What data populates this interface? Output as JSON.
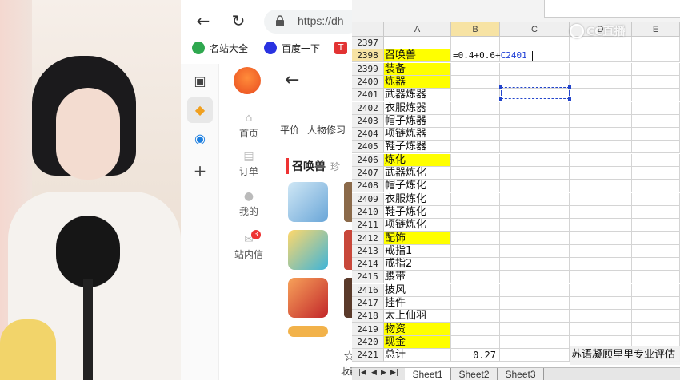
{
  "browser": {
    "url": "https://dh",
    "bookmarks": [
      {
        "label": "名站大全",
        "icon": "site-directory-icon",
        "color": "#2fa84f"
      },
      {
        "label": "百度一下",
        "icon": "baidu-paw-icon",
        "color": "#2932e1"
      },
      {
        "label": "T",
        "icon": "toutiao-icon",
        "color": "#e23333"
      }
    ],
    "app_nav": [
      {
        "label": "首页",
        "icon": "home-icon"
      },
      {
        "label": "订单",
        "icon": "order-icon"
      },
      {
        "label": "我的",
        "icon": "profile-icon"
      },
      {
        "label": "站内信",
        "icon": "message-icon",
        "badge": "3"
      }
    ],
    "tabs": [
      "平价",
      "人物修习"
    ],
    "section_title": "召唤兽",
    "section_more": "珍",
    "favorite_label": "收藏"
  },
  "sheet": {
    "columns": [
      "A",
      "B",
      "C",
      "D",
      "E"
    ],
    "rows": [
      {
        "num": "2397",
        "a": "",
        "yellow": false
      },
      {
        "num": "2398",
        "a": "召唤兽",
        "yellow": true
      },
      {
        "num": "2399",
        "a": "装备",
        "yellow": true
      },
      {
        "num": "2400",
        "a": "炼器",
        "yellow": true
      },
      {
        "num": "2401",
        "a": "武器炼器",
        "yellow": false
      },
      {
        "num": "2402",
        "a": "衣服炼器",
        "yellow": false
      },
      {
        "num": "2403",
        "a": "帽子炼器",
        "yellow": false
      },
      {
        "num": "2404",
        "a": "项链炼器",
        "yellow": false
      },
      {
        "num": "2405",
        "a": "鞋子炼器",
        "yellow": false
      },
      {
        "num": "2406",
        "a": "炼化",
        "yellow": true
      },
      {
        "num": "2407",
        "a": "武器炼化",
        "yellow": false
      },
      {
        "num": "2408",
        "a": "帽子炼化",
        "yellow": false
      },
      {
        "num": "2409",
        "a": "衣服炼化",
        "yellow": false
      },
      {
        "num": "2410",
        "a": "鞋子炼化",
        "yellow": false
      },
      {
        "num": "2411",
        "a": "项链炼化",
        "yellow": false
      },
      {
        "num": "2412",
        "a": "配饰",
        "yellow": true
      },
      {
        "num": "2413",
        "a": "戒指1",
        "yellow": false
      },
      {
        "num": "2414",
        "a": "戒指2",
        "yellow": false
      },
      {
        "num": "2415",
        "a": "腰带",
        "yellow": false
      },
      {
        "num": "2416",
        "a": "披风",
        "yellow": false
      },
      {
        "num": "2417",
        "a": "挂件",
        "yellow": false
      },
      {
        "num": "2418",
        "a": "太上仙羽",
        "yellow": false
      },
      {
        "num": "2419",
        "a": "物资",
        "yellow": true
      },
      {
        "num": "2420",
        "a": "现金",
        "yellow": true
      },
      {
        "num": "2421",
        "a": "总计",
        "yellow": false
      }
    ],
    "formula_prefix": "=0.4+0.6+",
    "formula_ref": "C2401",
    "total_value": "0.27",
    "sheet_tabs": [
      "Sheet1",
      "Sheet2",
      "Sheet3"
    ],
    "active_sheet": "Sheet1"
  },
  "overlay": {
    "watermark": "CC直播",
    "ticker": "苏语凝顾里里专业评估"
  }
}
